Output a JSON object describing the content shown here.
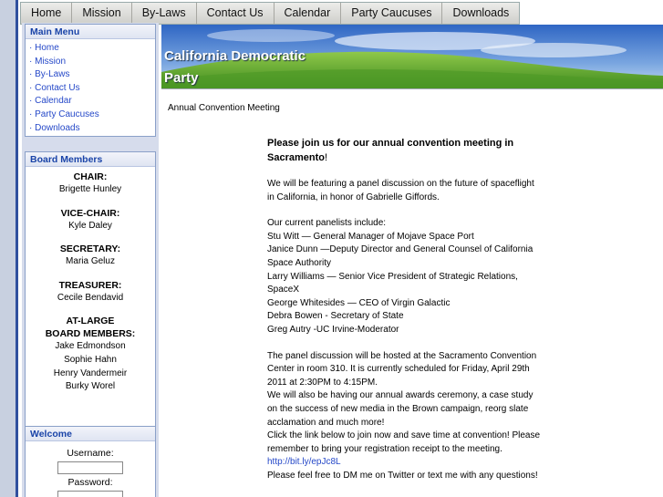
{
  "nav": {
    "tabs": [
      "Home",
      "Mission",
      "By-Laws",
      "Contact Us",
      "Calendar",
      "Party Caucuses",
      "Downloads"
    ]
  },
  "main_menu": {
    "title": "Main Menu",
    "items": [
      "· Home",
      "· Mission",
      "· By-Laws",
      "· Contact Us",
      "· Calendar",
      "· Party Caucuses",
      "· Downloads"
    ]
  },
  "board": {
    "title": "Board Members",
    "chair_role": "CHAIR:",
    "chair_name": "Brigette Hunley",
    "vice_role": "VICE-CHAIR:",
    "vice_name": "Kyle Daley",
    "secretary_role": "SECRETARY:",
    "secretary_name": "Maria Geluz",
    "treasurer_role": "TREASURER:",
    "treasurer_name": "Cecile Bendavid",
    "atlarge_role_1": "AT-LARGE",
    "atlarge_role_2": "BOARD MEMBERS:",
    "atlarge_names": [
      "Jake Edmondson",
      "Sophie Hahn",
      "Henry Vandermeir",
      "Burky Worel"
    ]
  },
  "welcome": {
    "title": "Welcome",
    "username_label": "Username:",
    "password_label": "Password:"
  },
  "banner": {
    "title_line1": "California Democratic",
    "title_line2": "Party"
  },
  "page": {
    "heading": "Annual Convention Meeting",
    "intro_bold": "Please join us for our annual convention meeting in Sacramento",
    "intro_end": "!",
    "panel_p": [
      "We will be featuring a panel discussion on the future of spaceflight",
      "in California, in honor of Gabrielle Giffords."
    ],
    "panelists": [
      "Our current panelists include:",
      "Stu Witt — General Manager of Mojave Space Port",
      "Janice Dunn —Deputy Director and General Counsel of California",
      "Space Authority",
      "Larry Williams — Senior Vice President of Strategic Relations,",
      "SpaceX",
      "George Whitesides — CEO of Virgin Galactic",
      "Debra Bowen - Secretary of State",
      "Greg Autry -UC Irvine-Moderator"
    ],
    "details": [
      "The panel discussion will be hosted at the Sacramento Convention",
      "Center in room 310. It is currently scheduled for Friday, April 29th",
      "2011 at 2:30PM to 4:15PM.",
      "We will also be having our annual awards ceremony, a case study",
      "on the success of new media in the Brown campaign, reorg slate",
      "acclamation and much more!",
      "Click the link below to join now and save time at convention! Please",
      "remember to bring your registration receipt to the meeting."
    ],
    "link": "http://bit.ly/epJc8L",
    "closing": "Please feel free to DM me on Twitter or text me with any questions!"
  }
}
